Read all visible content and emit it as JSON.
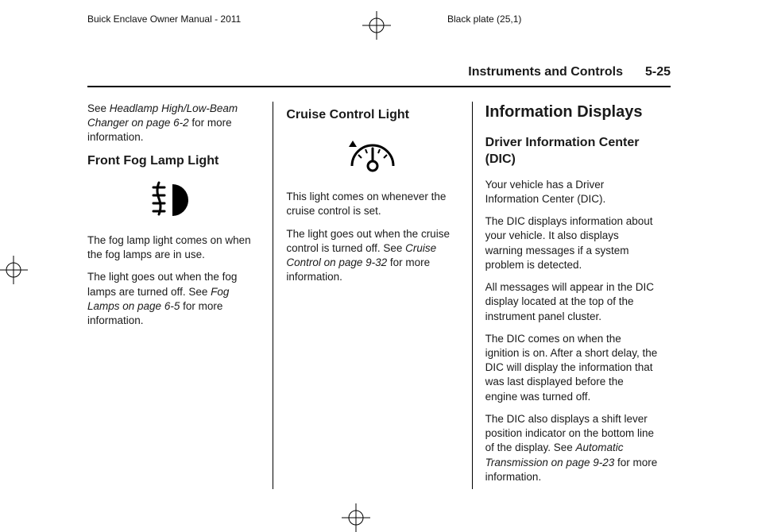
{
  "meta": {
    "doc_title": "Buick Enclave Owner Manual - 2011",
    "plate": "Black plate (25,1)"
  },
  "running_head": {
    "section": "Instruments and Controls",
    "page": "5-25"
  },
  "col1": {
    "intro_a": "See ",
    "intro_ref": "Headlamp High/Low-Beam Changer on page 6-2",
    "intro_b": " for more information.",
    "h2": "Front Fog Lamp Light",
    "p1": "The fog lamp light comes on when the fog lamps are in use.",
    "p2a": "The light goes out when the fog lamps are turned off. See ",
    "p2ref": "Fog Lamps on page 6-5",
    "p2b": " for more information."
  },
  "col2": {
    "h2": "Cruise Control Light",
    "p1": "This light comes on whenever the cruise control is set.",
    "p2a": "The light goes out when the cruise control is turned off. See ",
    "p2ref": "Cruise Control on page 9-32",
    "p2b": " for more information."
  },
  "col3": {
    "h1": "Information Displays",
    "h2": "Driver Information Center (DIC)",
    "p1": "Your vehicle has a Driver Information Center (DIC).",
    "p2": "The DIC displays information about your vehicle. It also displays warning messages if a system problem is detected.",
    "p3": "All messages will appear in the DIC display located at the top of the instrument panel cluster.",
    "p4": "The DIC comes on when the ignition is on. After a short delay, the DIC will display the information that was last displayed before the engine was turned off.",
    "p5a": "The DIC also displays a shift lever position indicator on the bottom line of the display. See ",
    "p5ref": "Automatic Transmission on page 9-23",
    "p5b": " for more information."
  }
}
